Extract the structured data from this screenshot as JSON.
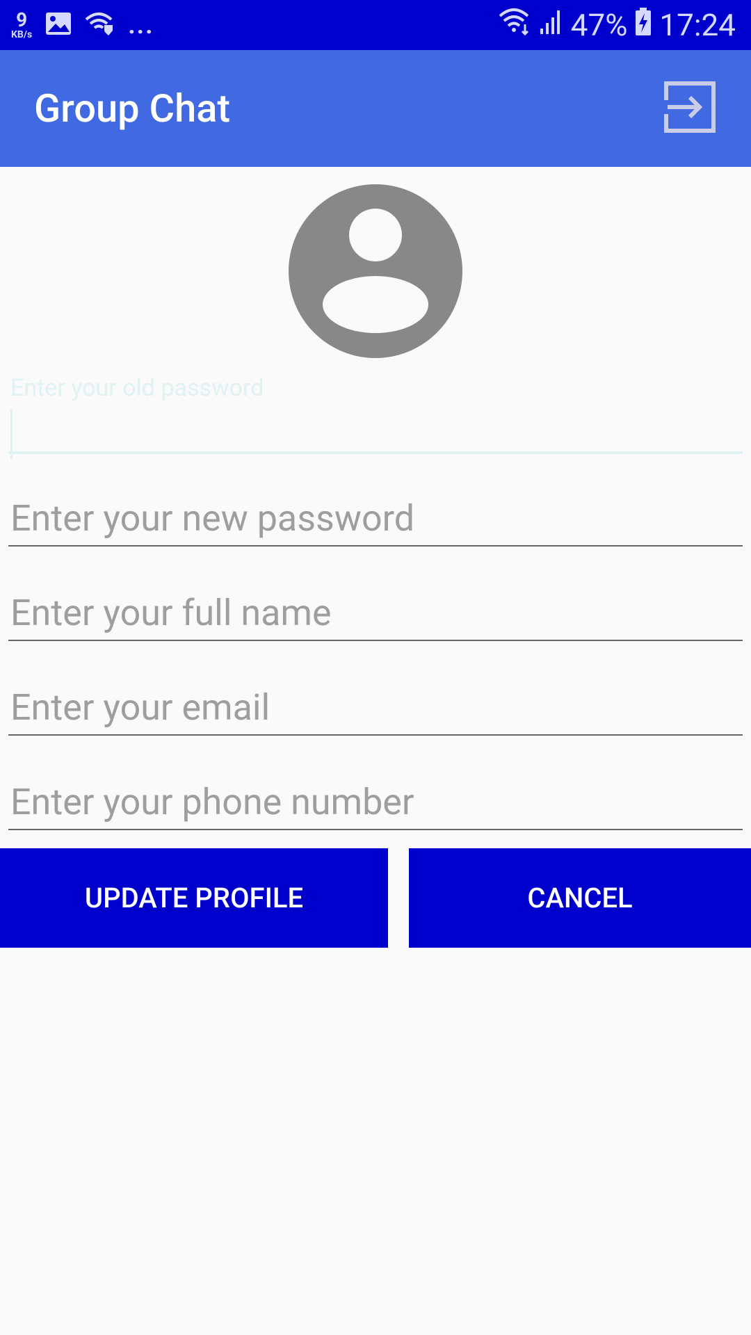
{
  "status_bar": {
    "speed_value": "9",
    "speed_unit": "KB/s",
    "more": "...",
    "battery": "47%",
    "time": "17:24"
  },
  "app_bar": {
    "title": "Group Chat",
    "action_icon": "logout-icon"
  },
  "form": {
    "old_password_hint": "Enter your old password",
    "new_password_placeholder": "Enter your new password",
    "full_name_placeholder": "Enter your full name",
    "email_placeholder": "Enter your email",
    "phone_placeholder": "Enter your phone number"
  },
  "buttons": {
    "update": "UPDATE PROFILE",
    "cancel": "CANCEL"
  },
  "colors": {
    "status_bar": "#0000cc",
    "app_bar": "#4169e1",
    "button": "#0000cc",
    "avatar": "#888888"
  }
}
